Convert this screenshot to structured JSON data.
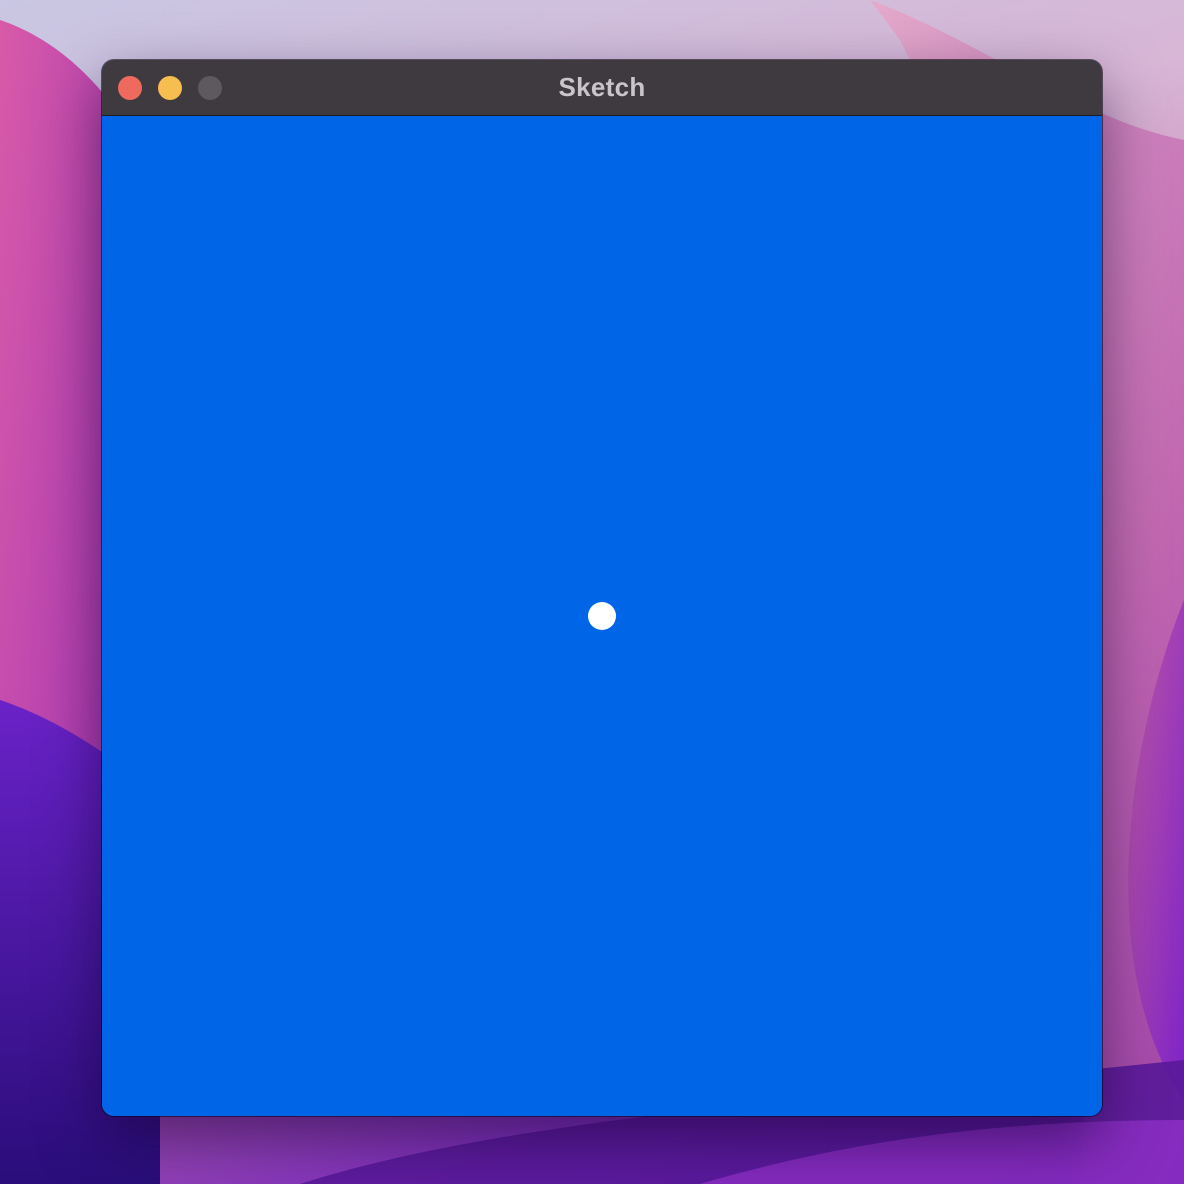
{
  "window": {
    "title": "Sketch",
    "controls": {
      "close_icon": "close-icon",
      "minimize_icon": "minimize-icon",
      "zoom_icon": "zoom-icon"
    }
  },
  "canvas": {
    "background_color": "#0066e7",
    "shapes": [
      {
        "type": "circle",
        "color": "#ffffff"
      }
    ]
  },
  "colors": {
    "titlebar": "#3f3a40",
    "close": "#ee6a5e",
    "minimize": "#f5be4f",
    "zoom_inactive": "#5d595e"
  }
}
